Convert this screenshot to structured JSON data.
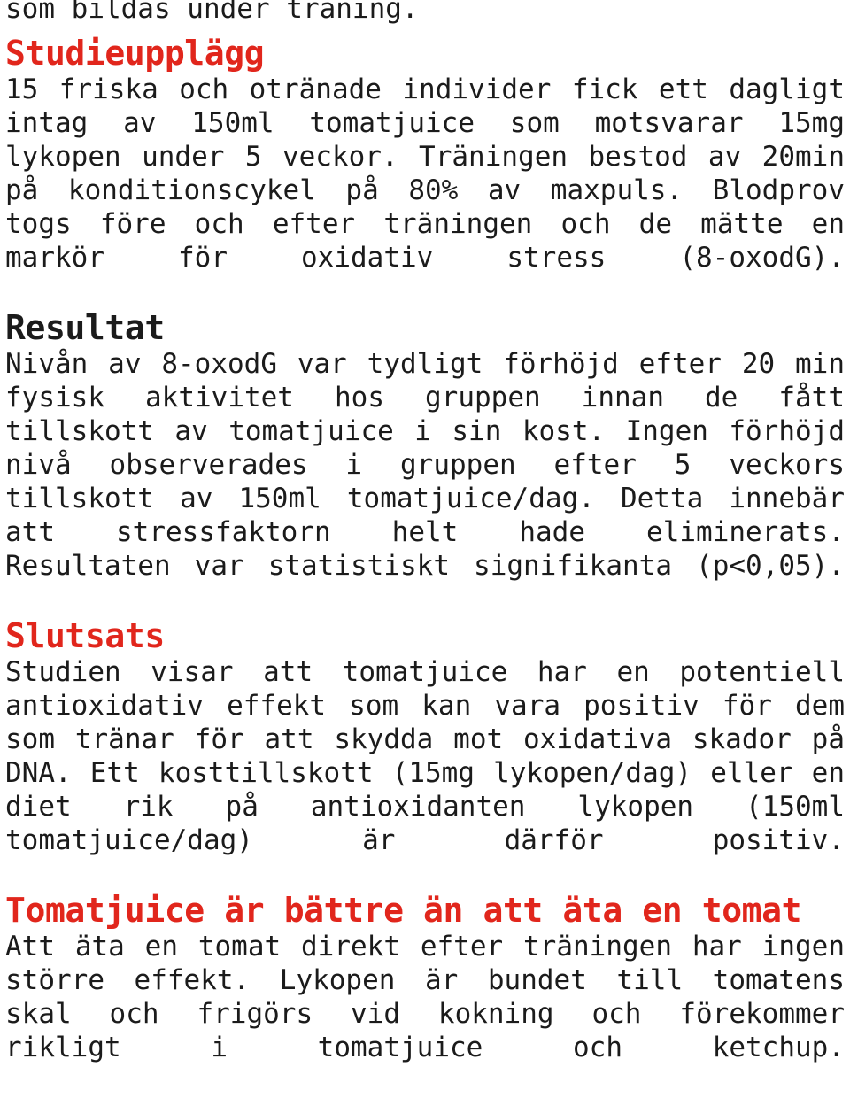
{
  "document": {
    "language": "sv",
    "text_color": "#1b1b1b",
    "accent_color": "#e1261c",
    "background_color": "#ffffff",
    "continuation_line": "som bildas under träning.",
    "sections": [
      {
        "id": "studieupplagg",
        "heading": "Studieupplägg",
        "heading_color": "#e1261c",
        "body": "15 friska och otränade individer fick ett dagligt intag av 150ml tomatjuice som motsvarar 15mg lykopen under 5 veckor. Träningen bestod av 20min på konditionscykel på 80% av maxpuls. Blodprov togs före och efter träningen och de mätte en markör för oxidativ stress (8-oxodG)."
      },
      {
        "id": "resultat",
        "heading": "Resultat",
        "heading_color": "#1b1b1b",
        "body": "Nivån av 8-oxodG var tydligt förhöjd efter 20 min fysisk aktivitet hos gruppen innan de fått tillskott av tomatjuice i sin kost. Ingen förhöjd nivå observerades i gruppen efter 5 veckors tillskott av 150ml tomatjuice/dag. Detta innebär att stressfaktorn helt hade eliminerats. Resultaten var statistiskt signifikanta (p<0,05)."
      },
      {
        "id": "slutsats",
        "heading": "Slutsats",
        "heading_color": "#e1261c",
        "body": "Studien visar att tomatjuice har en potentiell antioxidativ effekt som kan vara positiv för dem som tränar för att skydda mot oxidativa skador på DNA. Ett kosttillskott (15mg lykopen/dag) eller en diet rik på antioxidanten lykopen (150ml tomatjuice/dag) är därför positiv."
      },
      {
        "id": "tomatjuice-battre",
        "heading": "Tomatjuice är bättre än att äta en tomat",
        "heading_color": "#e1261c",
        "body": "Att äta en tomat direkt efter träningen har ingen större effekt. Lykopen är bundet till tomatens skal och frigörs vid kokning och förekommer rikligt i tomatjuice och ketchup."
      }
    ]
  }
}
